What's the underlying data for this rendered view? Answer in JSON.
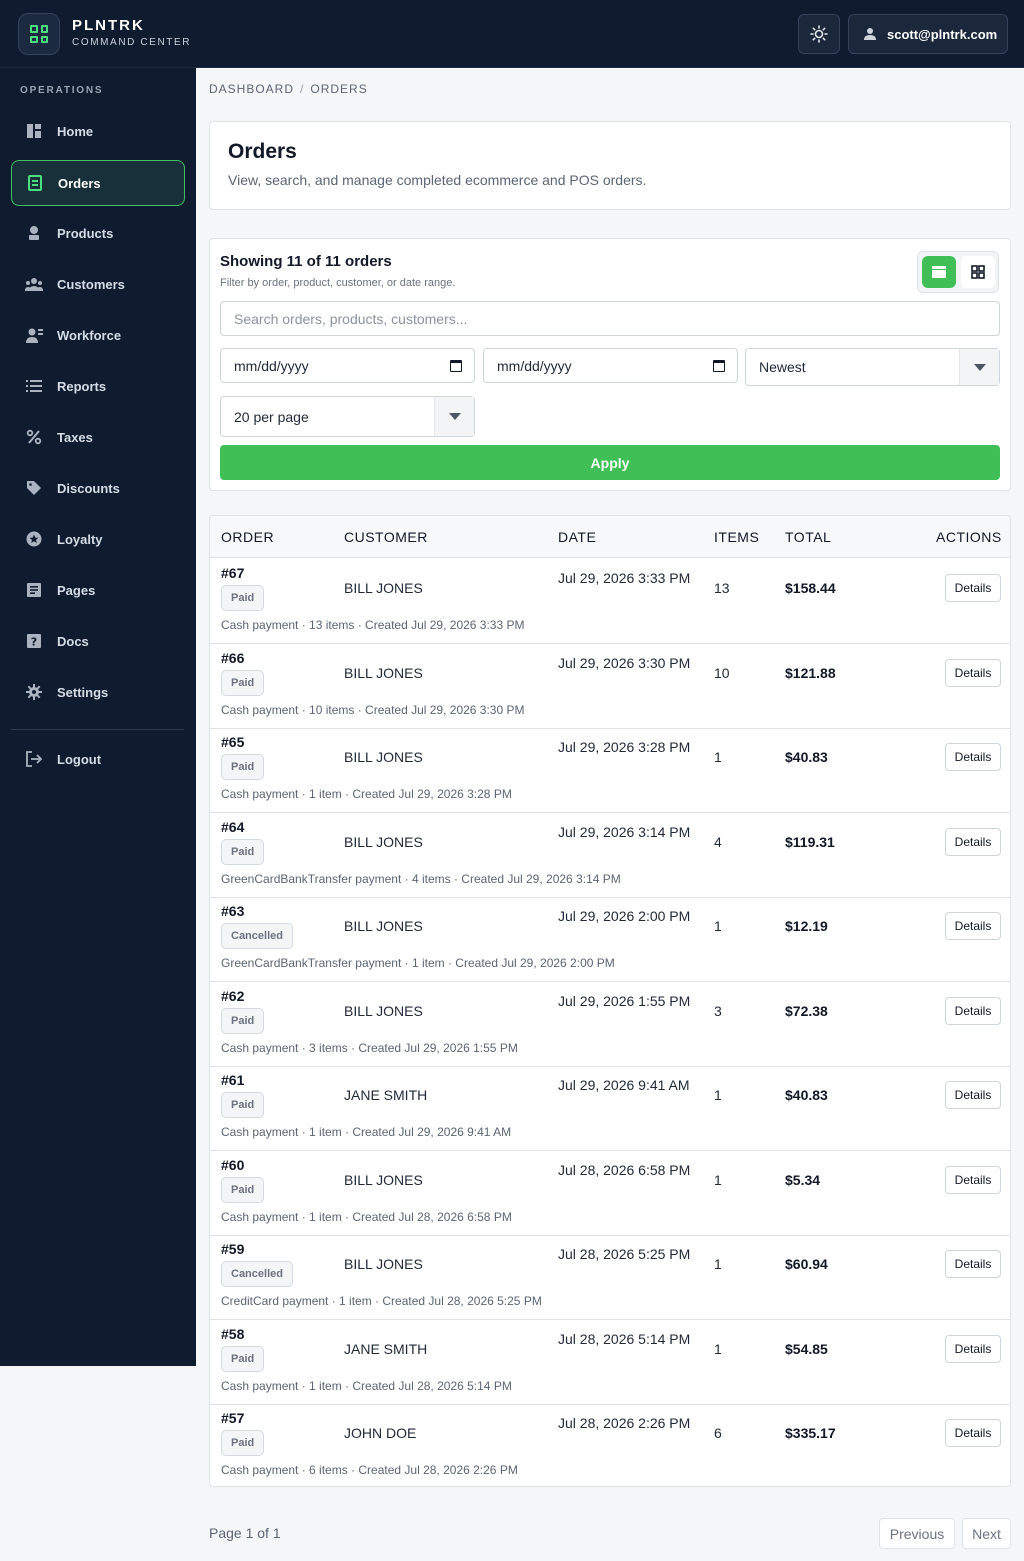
{
  "brand": {
    "name": "PLNTRK",
    "subtitle": "COMMAND CENTER"
  },
  "user": {
    "email": "scott@plntrk.com"
  },
  "sidebar": {
    "section": "OPERATIONS",
    "items": [
      {
        "label": "Home",
        "icon": "dashboard-icon"
      },
      {
        "label": "Orders",
        "icon": "receipt-icon",
        "active": true
      },
      {
        "label": "Products",
        "icon": "plant-icon"
      },
      {
        "label": "Customers",
        "icon": "people-icon"
      },
      {
        "label": "Workforce",
        "icon": "worker-icon"
      },
      {
        "label": "Reports",
        "icon": "list-icon"
      },
      {
        "label": "Taxes",
        "icon": "percent-icon"
      },
      {
        "label": "Discounts",
        "icon": "tag-icon"
      },
      {
        "label": "Loyalty",
        "icon": "star-icon"
      },
      {
        "label": "Pages",
        "icon": "page-icon"
      },
      {
        "label": "Docs",
        "icon": "help-icon"
      },
      {
        "label": "Settings",
        "icon": "gear-icon"
      }
    ],
    "logout": "Logout"
  },
  "breadcrumb": {
    "root": "DASHBOARD",
    "current": "ORDERS"
  },
  "header": {
    "title": "Orders",
    "description": "View, search, and manage completed ecommerce and POS orders."
  },
  "filters": {
    "showing": "Showing 11 of 11 orders",
    "hint": "Filter by order, product, customer, or date range.",
    "search_placeholder": "Search orders, products, customers...",
    "date_from": "mm/dd/yyyy",
    "date_to": "mm/dd/yyyy",
    "sort": "Newest",
    "per_page": "20 per page",
    "apply": "Apply"
  },
  "table": {
    "columns": [
      "ORDER",
      "CUSTOMER",
      "DATE",
      "ITEMS",
      "TOTAL",
      "ACTIONS"
    ],
    "details_label": "Details",
    "rows": [
      {
        "id": "#67",
        "status": "Paid",
        "customer": "BILL JONES",
        "date": "Jul 29, 2026 3:33 PM",
        "items": "13",
        "total": "$158.44",
        "meta": "Cash payment · 13 items · Created Jul 29, 2026 3:33 PM"
      },
      {
        "id": "#66",
        "status": "Paid",
        "customer": "BILL JONES",
        "date": "Jul 29, 2026 3:30 PM",
        "items": "10",
        "total": "$121.88",
        "meta": "Cash payment · 10 items · Created Jul 29, 2026 3:30 PM"
      },
      {
        "id": "#65",
        "status": "Paid",
        "customer": "BILL JONES",
        "date": "Jul 29, 2026 3:28 PM",
        "items": "1",
        "total": "$40.83",
        "meta": "Cash payment · 1 item · Created Jul 29, 2026 3:28 PM"
      },
      {
        "id": "#64",
        "status": "Paid",
        "customer": "BILL JONES",
        "date": "Jul 29, 2026 3:14 PM",
        "items": "4",
        "total": "$119.31",
        "meta": "GreenCardBankTransfer payment · 4 items · Created Jul 29, 2026 3:14 PM"
      },
      {
        "id": "#63",
        "status": "Cancelled",
        "customer": "BILL JONES",
        "date": "Jul 29, 2026 2:00 PM",
        "items": "1",
        "total": "$12.19",
        "meta": "GreenCardBankTransfer payment · 1 item · Created Jul 29, 2026 2:00 PM"
      },
      {
        "id": "#62",
        "status": "Paid",
        "customer": "BILL JONES",
        "date": "Jul 29, 2026 1:55 PM",
        "items": "3",
        "total": "$72.38",
        "meta": "Cash payment · 3 items · Created Jul 29, 2026 1:55 PM"
      },
      {
        "id": "#61",
        "status": "Paid",
        "customer": "JANE SMITH",
        "date": "Jul 29, 2026 9:41 AM",
        "items": "1",
        "total": "$40.83",
        "meta": "Cash payment · 1 item · Created Jul 29, 2026 9:41 AM"
      },
      {
        "id": "#60",
        "status": "Paid",
        "customer": "BILL JONES",
        "date": "Jul 28, 2026 6:58 PM",
        "items": "1",
        "total": "$5.34",
        "meta": "Cash payment · 1 item · Created Jul 28, 2026 6:58 PM"
      },
      {
        "id": "#59",
        "status": "Cancelled",
        "customer": "BILL JONES",
        "date": "Jul 28, 2026 5:25 PM",
        "items": "1",
        "total": "$60.94",
        "meta": "CreditCard payment · 1 item · Created Jul 28, 2026 5:25 PM"
      },
      {
        "id": "#58",
        "status": "Paid",
        "customer": "JANE SMITH",
        "date": "Jul 28, 2026 5:14 PM",
        "items": "1",
        "total": "$54.85",
        "meta": "Cash payment · 1 item · Created Jul 28, 2026 5:14 PM"
      },
      {
        "id": "#57",
        "status": "Paid",
        "customer": "JOHN DOE",
        "date": "Jul 28, 2026 2:26 PM",
        "items": "6",
        "total": "$335.17",
        "meta": "Cash payment · 6 items · Created Jul 28, 2026 2:26 PM"
      }
    ]
  },
  "pagination": {
    "label": "Page 1 of 1",
    "previous": "Previous",
    "next": "Next"
  },
  "colors": {
    "accent": "#3fbf55",
    "sidebar": "#0f1b2f"
  }
}
